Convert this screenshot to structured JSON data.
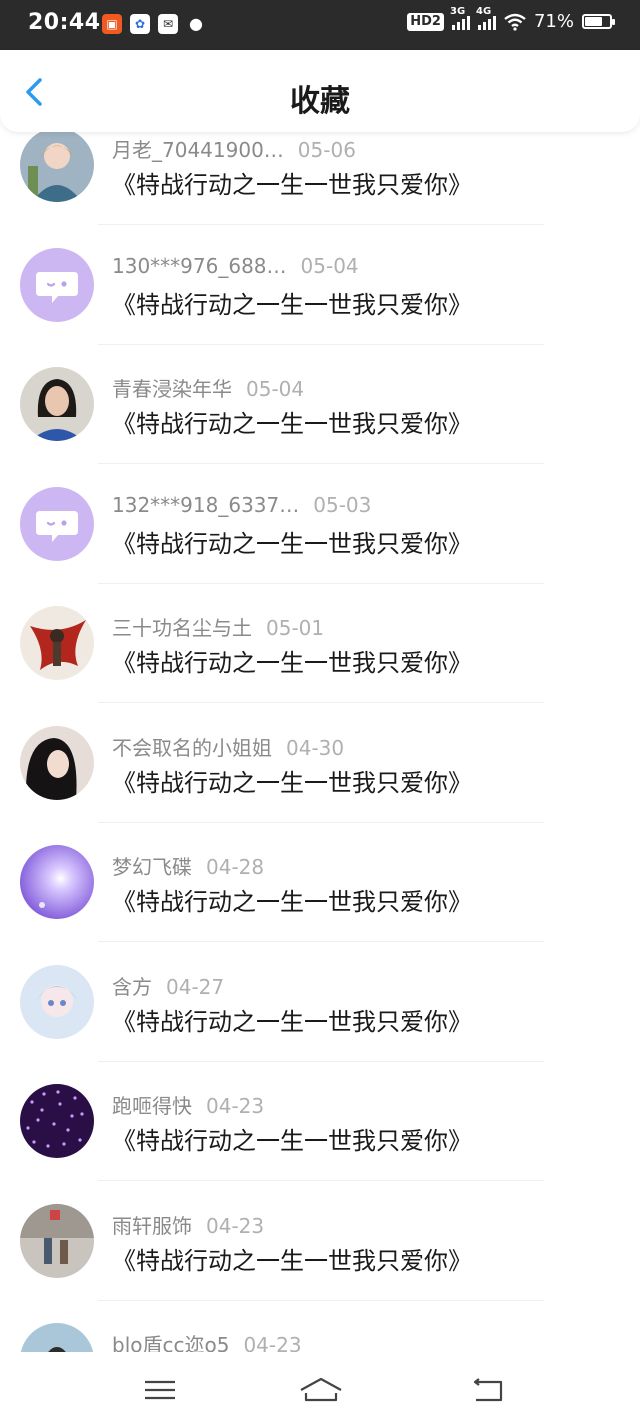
{
  "status_bar": {
    "time": "20:44",
    "apps": [
      "app-notification-orange",
      "baidu-icon",
      "mail-icon",
      "chat-icon"
    ],
    "hd": "HD2",
    "net1": "3G",
    "net2": "4G",
    "battery": "71%",
    "battery_level": 0.71
  },
  "header": {
    "title": "收藏",
    "back_icon": "chevron-left-icon"
  },
  "items": [
    {
      "user": "月老_70441900…",
      "date": "05-06",
      "title": "《特战行动之一生一世我只爱你》",
      "avatar": "anime-girl"
    },
    {
      "user": "130***976_688…",
      "date": "05-04",
      "title": "《特战行动之一生一世我只爱你》",
      "avatar": "default-chat"
    },
    {
      "user": "青春浸染年华",
      "date": "05-04",
      "title": "《特战行动之一生一世我只爱你》",
      "avatar": "photo-girl"
    },
    {
      "user": "132***918_6337…",
      "date": "05-03",
      "title": "《特战行动之一生一世我只爱你》",
      "avatar": "default-chat"
    },
    {
      "user": "三十功名尘与土",
      "date": "05-01",
      "title": "《特战行动之一生一世我只爱你》",
      "avatar": "warrior"
    },
    {
      "user": "不会取名的小姐姐",
      "date": "04-30",
      "title": "《特战行动之一生一世我只爱你》",
      "avatar": "dark-girl"
    },
    {
      "user": "梦幻飞碟",
      "date": "04-28",
      "title": "《特战行动之一生一世我只爱你》",
      "avatar": "purple-light"
    },
    {
      "user": "含方",
      "date": "04-27",
      "title": "《特战行动之一生一世我只爱你》",
      "avatar": "pastel-anime"
    },
    {
      "user": "跑咂得快",
      "date": "04-23",
      "title": "《特战行动之一生一世我只爱你》",
      "avatar": "purple-sparkle"
    },
    {
      "user": "雨轩服饰",
      "date": "04-23",
      "title": "《特战行动之一生一世我只爱你》",
      "avatar": "street-photo"
    },
    {
      "user": "blo盾cc迩o5",
      "date": "04-23",
      "title": "",
      "avatar": "blue-photo"
    }
  ],
  "navbar": {
    "menu_icon": "menu-icon",
    "home_icon": "home-icon",
    "back_icon": "back-arrow-icon"
  },
  "colors": {
    "accent": "#2a9cf0",
    "chat_avatar_bg": "#cdb7f2"
  }
}
